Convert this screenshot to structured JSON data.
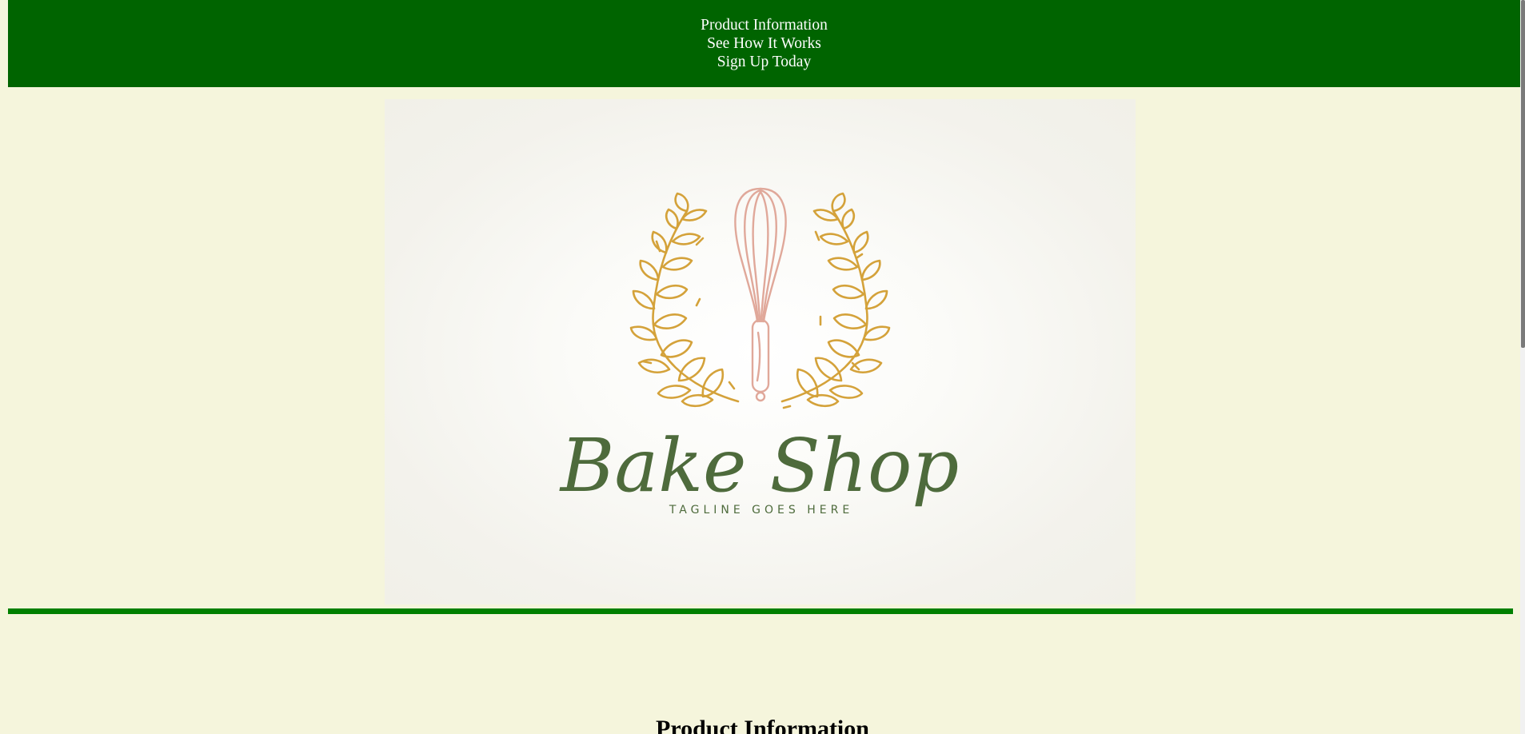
{
  "nav": {
    "items": [
      {
        "label": "Product Information"
      },
      {
        "label": "See How It Works"
      },
      {
        "label": "Sign Up Today"
      }
    ]
  },
  "hero": {
    "brand_name": "Bake Shop",
    "tagline": "TAGLINE GOES HERE",
    "icons": [
      "wheat-wreath-left-icon",
      "whisk-icon",
      "wheat-wreath-right-icon"
    ]
  },
  "section": {
    "title": "Product Information"
  },
  "colors": {
    "nav_bg": "#006400",
    "page_bg": "#f5f5dc",
    "divider": "#008000",
    "brand_text": "#4e6b3c",
    "wheat": "#d4a23a",
    "whisk": "#e0a89a"
  }
}
